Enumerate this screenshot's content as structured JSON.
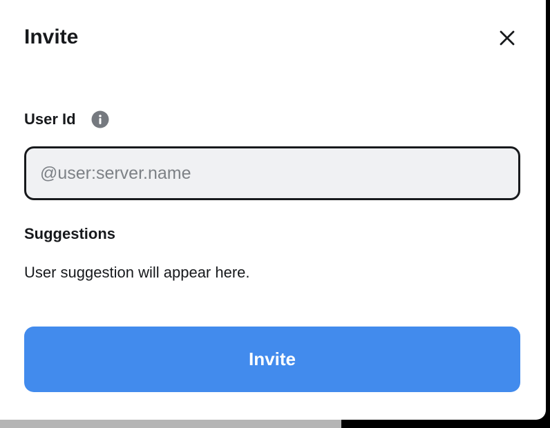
{
  "dialog": {
    "title": "Invite",
    "close_icon": "close-icon"
  },
  "user_id_field": {
    "label": "User Id",
    "info_icon": "info-icon",
    "value": "",
    "placeholder": "@user:server.name"
  },
  "suggestions": {
    "title": "Suggestions",
    "empty_text": "User suggestion will appear here."
  },
  "actions": {
    "invite_label": "Invite"
  },
  "colors": {
    "primary": "#428bed",
    "text": "#17191c",
    "input_background": "#f0f1f3",
    "placeholder": "#7d8186",
    "info_icon": "#75797f"
  }
}
